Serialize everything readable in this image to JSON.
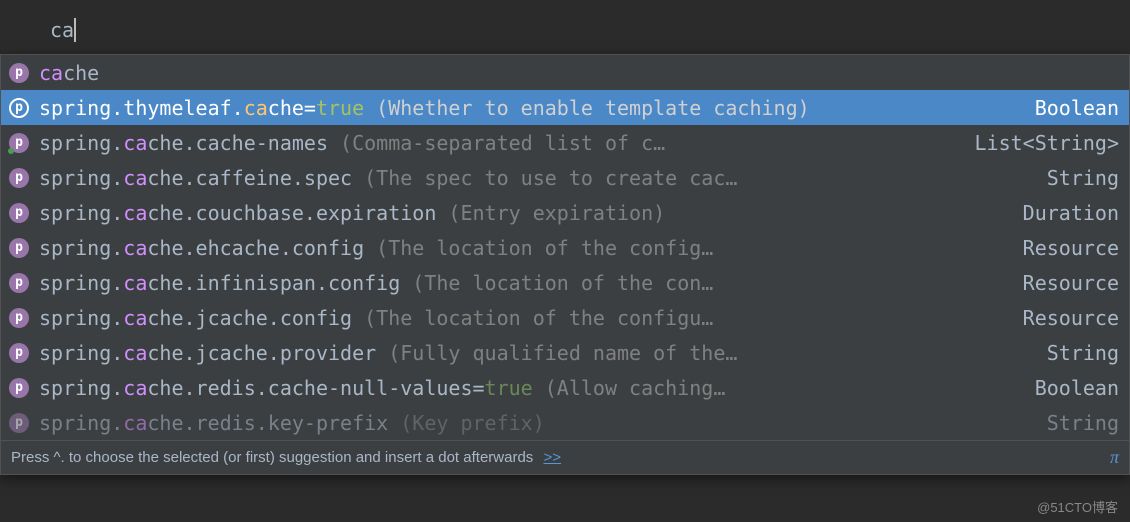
{
  "editor": {
    "input_typed": "ca"
  },
  "completions": [
    {
      "icon": "p",
      "selected": false,
      "dimmed": false,
      "has_dot": false,
      "parts": [
        {
          "text": "ca",
          "cls": "match"
        },
        {
          "text": "che",
          "cls": "rest"
        }
      ],
      "type": ""
    },
    {
      "icon": "p",
      "selected": true,
      "dimmed": false,
      "has_dot": false,
      "parts": [
        {
          "text": "spring.thymeleaf.",
          "cls": "rest"
        },
        {
          "text": "ca",
          "cls": "match"
        },
        {
          "text": "che",
          "cls": "rest"
        },
        {
          "text": "=",
          "cls": "rest"
        },
        {
          "text": "true",
          "cls": "value-true"
        },
        {
          "text": " (Whether to enable template caching)",
          "cls": "desc"
        }
      ],
      "type": "Boolean"
    },
    {
      "icon": "p",
      "selected": false,
      "dimmed": false,
      "has_dot": true,
      "parts": [
        {
          "text": "spring.",
          "cls": "rest"
        },
        {
          "text": "ca",
          "cls": "match"
        },
        {
          "text": "che.cache-names ",
          "cls": "rest"
        },
        {
          "text": "(Comma-separated list of c…",
          "cls": "desc"
        }
      ],
      "type": "List<String>"
    },
    {
      "icon": "p",
      "selected": false,
      "dimmed": false,
      "has_dot": false,
      "parts": [
        {
          "text": "spring.",
          "cls": "rest"
        },
        {
          "text": "ca",
          "cls": "match"
        },
        {
          "text": "che.caffeine.spec ",
          "cls": "rest"
        },
        {
          "text": "(The spec to use to create cac…",
          "cls": "desc"
        }
      ],
      "type": "String"
    },
    {
      "icon": "p",
      "selected": false,
      "dimmed": false,
      "has_dot": false,
      "parts": [
        {
          "text": "spring.",
          "cls": "rest"
        },
        {
          "text": "ca",
          "cls": "match"
        },
        {
          "text": "che.couchbase.expiration ",
          "cls": "rest"
        },
        {
          "text": "(Entry expiration)",
          "cls": "desc"
        }
      ],
      "type": "Duration"
    },
    {
      "icon": "p",
      "selected": false,
      "dimmed": false,
      "has_dot": false,
      "parts": [
        {
          "text": "spring.",
          "cls": "rest"
        },
        {
          "text": "ca",
          "cls": "match"
        },
        {
          "text": "che.ehcache.config ",
          "cls": "rest"
        },
        {
          "text": "(The location of the config…",
          "cls": "desc"
        }
      ],
      "type": "Resource"
    },
    {
      "icon": "p",
      "selected": false,
      "dimmed": false,
      "has_dot": false,
      "parts": [
        {
          "text": "spring.",
          "cls": "rest"
        },
        {
          "text": "ca",
          "cls": "match"
        },
        {
          "text": "che.infinispan.config ",
          "cls": "rest"
        },
        {
          "text": "(The location of the con…",
          "cls": "desc"
        }
      ],
      "type": "Resource"
    },
    {
      "icon": "p",
      "selected": false,
      "dimmed": false,
      "has_dot": false,
      "parts": [
        {
          "text": "spring.",
          "cls": "rest"
        },
        {
          "text": "ca",
          "cls": "match"
        },
        {
          "text": "che.jcache.config ",
          "cls": "rest"
        },
        {
          "text": "(The location of the configu…",
          "cls": "desc"
        }
      ],
      "type": "Resource"
    },
    {
      "icon": "p",
      "selected": false,
      "dimmed": false,
      "has_dot": false,
      "parts": [
        {
          "text": "spring.",
          "cls": "rest"
        },
        {
          "text": "ca",
          "cls": "match"
        },
        {
          "text": "che.jcache.provider ",
          "cls": "rest"
        },
        {
          "text": "(Fully qualified name of the…",
          "cls": "desc"
        }
      ],
      "type": "String"
    },
    {
      "icon": "p",
      "selected": false,
      "dimmed": false,
      "has_dot": false,
      "parts": [
        {
          "text": "spring.",
          "cls": "rest"
        },
        {
          "text": "ca",
          "cls": "match"
        },
        {
          "text": "che.redis.cache-null-values",
          "cls": "rest"
        },
        {
          "text": "=",
          "cls": "rest"
        },
        {
          "text": "true",
          "cls": "value-true"
        },
        {
          "text": " (Allow caching…",
          "cls": "desc"
        }
      ],
      "type": "Boolean"
    },
    {
      "icon": "p",
      "selected": false,
      "dimmed": true,
      "has_dot": false,
      "parts": [
        {
          "text": "spring.",
          "cls": "rest"
        },
        {
          "text": "ca",
          "cls": "match"
        },
        {
          "text": "che.redis.key-prefix ",
          "cls": "rest"
        },
        {
          "text": "(Key prefix)",
          "cls": "desc"
        }
      ],
      "type": "String"
    }
  ],
  "footer": {
    "text": "Press ^. to choose the selected (or first) suggestion and insert a dot afterwards",
    "link": ">>",
    "pi": "π"
  },
  "watermark": "@51CTO博客"
}
